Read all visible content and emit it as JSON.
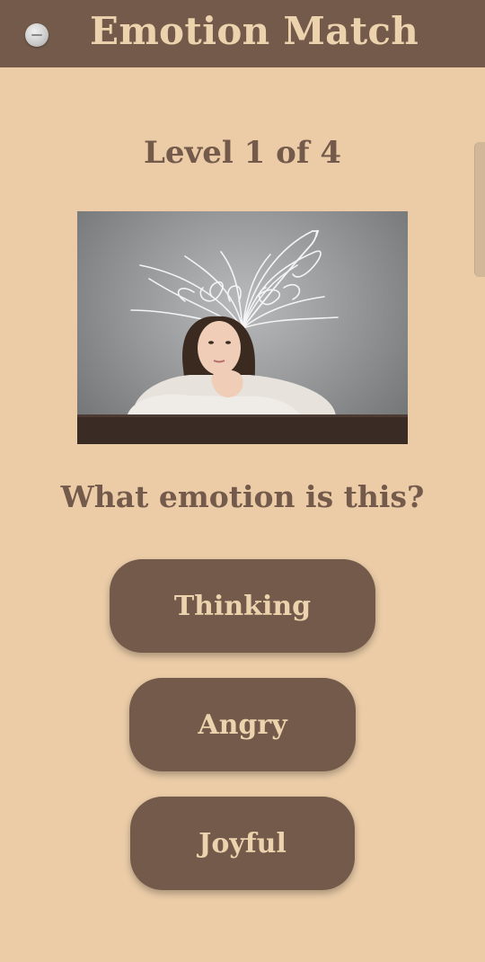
{
  "header": {
    "title": "Emotion Match",
    "back_icon": "back-icon"
  },
  "game": {
    "level_text": "Level 1 of 4",
    "question": "What emotion is this?",
    "answers": [
      "Thinking",
      "Angry",
      "Joyful"
    ]
  },
  "colors": {
    "background": "#ebcca7",
    "header": "#735a4a",
    "accent_text": "#ecd3ad",
    "button": "#735a4a"
  }
}
